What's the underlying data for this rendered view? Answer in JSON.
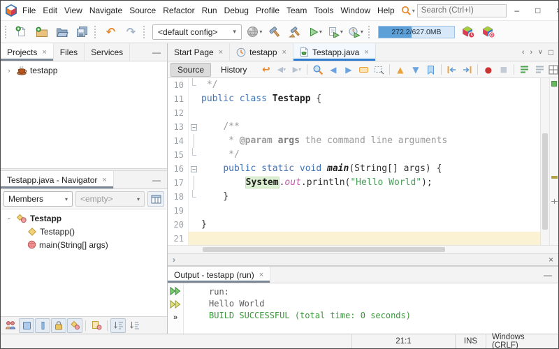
{
  "menubar": {
    "items": [
      "File",
      "Edit",
      "View",
      "Navigate",
      "Source",
      "Refactor",
      "Run",
      "Debug",
      "Profile",
      "Team",
      "Tools",
      "Window",
      "Help"
    ],
    "search_placeholder": "Search (Ctrl+I)"
  },
  "window_controls": {
    "minimize": "–",
    "maximize": "□",
    "close": "×"
  },
  "toolbar": {
    "groups": [
      {
        "grip": true,
        "icons": [
          "new-file",
          "new-project",
          "open-project",
          "save-all"
        ]
      },
      {
        "grip": true,
        "icons": [
          "undo",
          "redo"
        ]
      },
      {
        "grip": true,
        "combo": "<default config>"
      },
      {
        "icons": [
          "globe-caret"
        ]
      },
      {
        "icons": [
          "build",
          "clean-build"
        ]
      },
      {
        "icons": [
          "run-caret",
          "debug-caret",
          "profile-caret"
        ]
      },
      {
        "grip": true,
        "memory": "272.2/627.0MB",
        "fraction": 0.434
      },
      {
        "icons": [
          "profile-gc",
          "profile-stop"
        ]
      }
    ]
  },
  "left": {
    "projects": {
      "tabs": [
        {
          "label": "Projects",
          "closable": true,
          "active": true
        },
        {
          "label": "Files",
          "closable": false,
          "active": false
        },
        {
          "label": "Services",
          "closable": false,
          "active": false
        }
      ],
      "tree": [
        {
          "icon": "java-project",
          "label": "testapp",
          "expanded": false,
          "level": 0,
          "bold": false
        }
      ]
    },
    "navigator": {
      "tab_label": "Testapp.java - Navigator",
      "members_value": "Members",
      "empty_value": "<empty>",
      "tree": [
        {
          "icon": "class",
          "label": "Testapp",
          "expanded": true,
          "level": 0,
          "bold": true
        },
        {
          "icon": "constructor",
          "label": "Testapp()",
          "level": 1,
          "bold": false
        },
        {
          "icon": "method",
          "label": "main(String[] args)",
          "level": 1,
          "bold": false
        }
      ],
      "filters": [
        "inherited",
        "fields:pressed",
        "static:pressed",
        "non-public:pressed",
        "inner:pressed",
        "|",
        "show-anon",
        "|",
        "sort-position:pressed",
        "sort-alpha"
      ]
    }
  },
  "editor": {
    "tabs": [
      {
        "label": "Start Page",
        "icon": "",
        "active": false
      },
      {
        "label": "testapp",
        "icon": "history-clock",
        "active": false
      },
      {
        "label": "Testapp.java",
        "icon": "java-file",
        "active": true
      }
    ],
    "toolbar": {
      "source_label": "Source",
      "history_label": "History",
      "icons": [
        "last-edit",
        "nav-back",
        "nav-forward",
        "|",
        "find",
        "find-prev",
        "find-next",
        "highlight",
        "rect-select",
        "|",
        "prev-bookmark",
        "next-bookmark",
        "toggle-bookmark",
        "|",
        "shift-left",
        "shift-right",
        "|",
        "macro-record",
        "macro-stop",
        "|",
        "comment",
        "uncomment"
      ]
    },
    "code": {
      "lines": [
        {
          "n": 10,
          "fold": "end",
          "tokens": [
            {
              "c": "cm",
              "t": " */"
            }
          ]
        },
        {
          "n": 11,
          "fold": "",
          "tokens": [
            {
              "c": "kw",
              "t": "public class "
            },
            {
              "c": "cls",
              "t": "Testapp"
            },
            {
              "c": "pl",
              "t": " {"
            }
          ]
        },
        {
          "n": 12,
          "fold": "",
          "tokens": []
        },
        {
          "n": 13,
          "fold": "start",
          "tokens": [
            {
              "c": "pl",
              "t": "    "
            },
            {
              "c": "cm",
              "t": "/**"
            }
          ]
        },
        {
          "n": 14,
          "fold": "mid",
          "tokens": [
            {
              "c": "pl",
              "t": "     "
            },
            {
              "c": "cm",
              "t": "* "
            },
            {
              "c": "tag",
              "t": "@param"
            },
            {
              "c": "cm",
              "t": " "
            },
            {
              "c": "argb",
              "t": "args"
            },
            {
              "c": "cm",
              "t": " the command line arguments"
            }
          ]
        },
        {
          "n": 15,
          "fold": "end",
          "tokens": [
            {
              "c": "pl",
              "t": "     "
            },
            {
              "c": "cm",
              "t": "*/"
            }
          ]
        },
        {
          "n": 16,
          "fold": "start",
          "tokens": [
            {
              "c": "pl",
              "t": "    "
            },
            {
              "c": "kw",
              "t": "public static void "
            },
            {
              "c": "mth",
              "t": "main"
            },
            {
              "c": "pl",
              "t": "(String[] args) {"
            }
          ]
        },
        {
          "n": 17,
          "fold": "mid",
          "tokens": [
            {
              "c": "pl",
              "t": "        "
            },
            {
              "c": "sys",
              "t": "System"
            },
            {
              "c": "pl",
              "t": "."
            },
            {
              "c": "fld",
              "t": "out"
            },
            {
              "c": "pl",
              "t": ".println("
            },
            {
              "c": "str",
              "t": "\"Hello World\""
            },
            {
              "c": "pl",
              "t": ");"
            }
          ]
        },
        {
          "n": 18,
          "fold": "end",
          "tokens": [
            {
              "c": "pl",
              "t": "    }"
            }
          ]
        },
        {
          "n": 19,
          "fold": "",
          "tokens": []
        },
        {
          "n": 20,
          "fold": "",
          "tokens": [
            {
              "c": "pl",
              "t": "}"
            }
          ]
        },
        {
          "n": 21,
          "fold": "",
          "current": true,
          "tokens": []
        }
      ]
    },
    "scroll": {
      "vthumb_top": 0.33,
      "vthumb_size": 0.58,
      "hthumb_left": 0.09,
      "hthumb_size": 0.62,
      "stripe_marks": [
        {
          "type": "ok",
          "pos": 0.0
        },
        {
          "type": "warn",
          "pos": 0.57
        },
        {
          "type": "caret",
          "pos": 0.72
        }
      ]
    }
  },
  "output": {
    "tab_label": "Output - testapp (run)",
    "side_icons": [
      "rerun",
      "rerun-alt",
      "more"
    ],
    "lines": [
      {
        "text": "run:",
        "cls": "plain"
      },
      {
        "text": "Hello World",
        "cls": "plain"
      },
      {
        "text": "BUILD SUCCESSFUL (total time: 0 seconds)",
        "cls": "success"
      }
    ]
  },
  "findbar": {
    "chevron": "›",
    "close": "×"
  },
  "statusbar": {
    "caret_position": "21:1",
    "insert_mode": "INS",
    "line_ending": "Windows (CRLF)"
  },
  "colors": {
    "accent_blue": "#2d7ad1",
    "keyword": "#3e74b9",
    "string": "#47a05a",
    "comment": "#9b9b9b",
    "success_green": "#389838",
    "current_line": "#fbf1d3",
    "memory_fill": "#5d9fd7"
  }
}
